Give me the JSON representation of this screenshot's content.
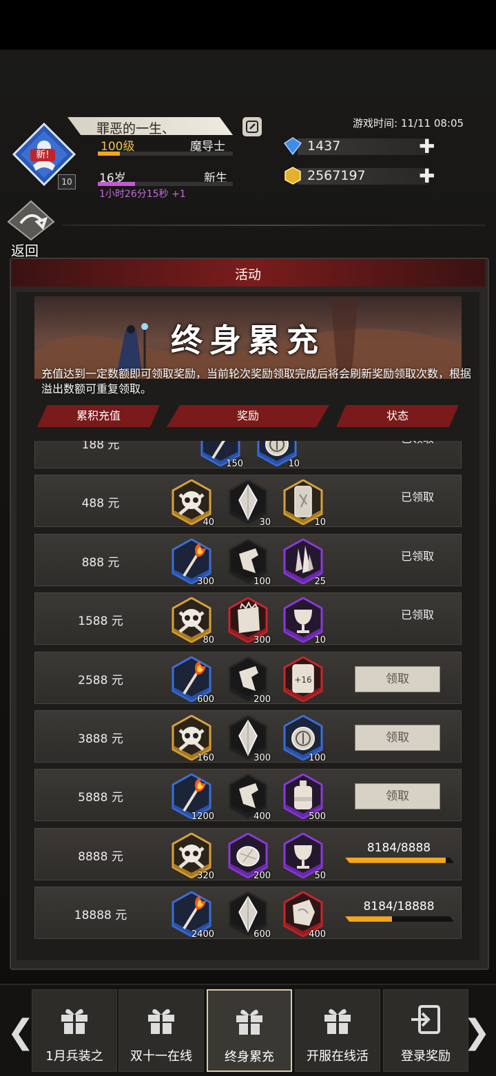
{
  "header": {
    "player_name": "罪恶的一生、",
    "avatar_badge": "新!",
    "avatar_level": "10",
    "level": "100级",
    "class": "魔导士",
    "age": "16岁",
    "stage": "新生",
    "timer": "1小时26分15秒 +1",
    "game_time": "游戏时间: 11/11 08:05",
    "diamonds": "1437",
    "gold": "2567197",
    "back_label": "返回"
  },
  "panel": {
    "title": "活动",
    "banner_title": "终身累充",
    "description": "充值达到一定数额即可领取奖励，当前轮次奖励领取完成后将会刷新奖励领取次数，根据溢出数额可重复领取。",
    "columns": [
      "累积充值",
      "奖励",
      "状态"
    ]
  },
  "rows": [
    {
      "amount": "188 元",
      "status": "已领取",
      "rewards": [
        {
          "icon": "torch-icon",
          "qty": "150",
          "frame": "blue"
        },
        {
          "icon": "compass-icon",
          "qty": "10",
          "frame": "blue"
        }
      ]
    },
    {
      "amount": "488 元",
      "status": "已领取",
      "rewards": [
        {
          "icon": "skull-icon",
          "qty": "40",
          "frame": "gold"
        },
        {
          "icon": "crystal-icon",
          "qty": "30",
          "frame": "dark"
        },
        {
          "icon": "scroll-icon",
          "qty": "10",
          "frame": "gold"
        }
      ]
    },
    {
      "amount": "888 元",
      "status": "已领取",
      "rewards": [
        {
          "icon": "torch-icon",
          "qty": "300",
          "frame": "blue"
        },
        {
          "icon": "shard-icon",
          "qty": "100",
          "frame": "dark"
        },
        {
          "icon": "crystal-cluster-icon",
          "qty": "25",
          "frame": "purple"
        }
      ]
    },
    {
      "amount": "1588 元",
      "status": "已领取",
      "rewards": [
        {
          "icon": "skull-icon",
          "qty": "80",
          "frame": "gold"
        },
        {
          "icon": "parchment-icon",
          "qty": "300",
          "frame": "red"
        },
        {
          "icon": "goblet-icon",
          "qty": "10",
          "frame": "purple"
        }
      ]
    },
    {
      "amount": "2588 元",
      "status": "领取",
      "rewards": [
        {
          "icon": "torch-icon",
          "qty": "600",
          "frame": "blue"
        },
        {
          "icon": "shard-icon",
          "qty": "200",
          "frame": "dark"
        },
        {
          "icon": "plus16-scroll-icon",
          "qty": "",
          "frame": "red"
        }
      ]
    },
    {
      "amount": "3888 元",
      "status": "领取",
      "rewards": [
        {
          "icon": "skull-icon",
          "qty": "160",
          "frame": "gold"
        },
        {
          "icon": "crystal-icon",
          "qty": "300",
          "frame": "dark"
        },
        {
          "icon": "compass-icon",
          "qty": "100",
          "frame": "blue"
        }
      ]
    },
    {
      "amount": "5888 元",
      "status": "领取",
      "rewards": [
        {
          "icon": "torch-icon",
          "qty": "1200",
          "frame": "blue"
        },
        {
          "icon": "shard-icon",
          "qty": "400",
          "frame": "dark"
        },
        {
          "icon": "potion-icon",
          "qty": "500",
          "frame": "purple"
        }
      ]
    },
    {
      "amount": "8888 元",
      "status": "8184/8888",
      "progress": 0.921,
      "rewards": [
        {
          "icon": "skull-icon",
          "qty": "320",
          "frame": "gold"
        },
        {
          "icon": "stone-icon",
          "qty": "200",
          "frame": "purple"
        },
        {
          "icon": "goblet-icon",
          "qty": "50",
          "frame": "purple"
        }
      ]
    },
    {
      "amount": "18888 元",
      "status": "8184/18888",
      "progress": 0.433,
      "rewards": [
        {
          "icon": "torch-icon",
          "qty": "2400",
          "frame": "blue"
        },
        {
          "icon": "crystal-icon",
          "qty": "600",
          "frame": "dark"
        },
        {
          "icon": "ore-icon",
          "qty": "400",
          "frame": "red"
        }
      ]
    }
  ],
  "tabs": [
    {
      "label": "1月兵装之",
      "active": false
    },
    {
      "label": "双十一在线",
      "active": false
    },
    {
      "label": "终身累充",
      "active": true
    },
    {
      "label": "开服在线活",
      "active": false
    },
    {
      "label": "登录奖励",
      "active": false
    }
  ],
  "colors": {
    "accent": "#7a1a1a",
    "progress": "#f4a71a",
    "gold_text": "#f2c14a"
  }
}
